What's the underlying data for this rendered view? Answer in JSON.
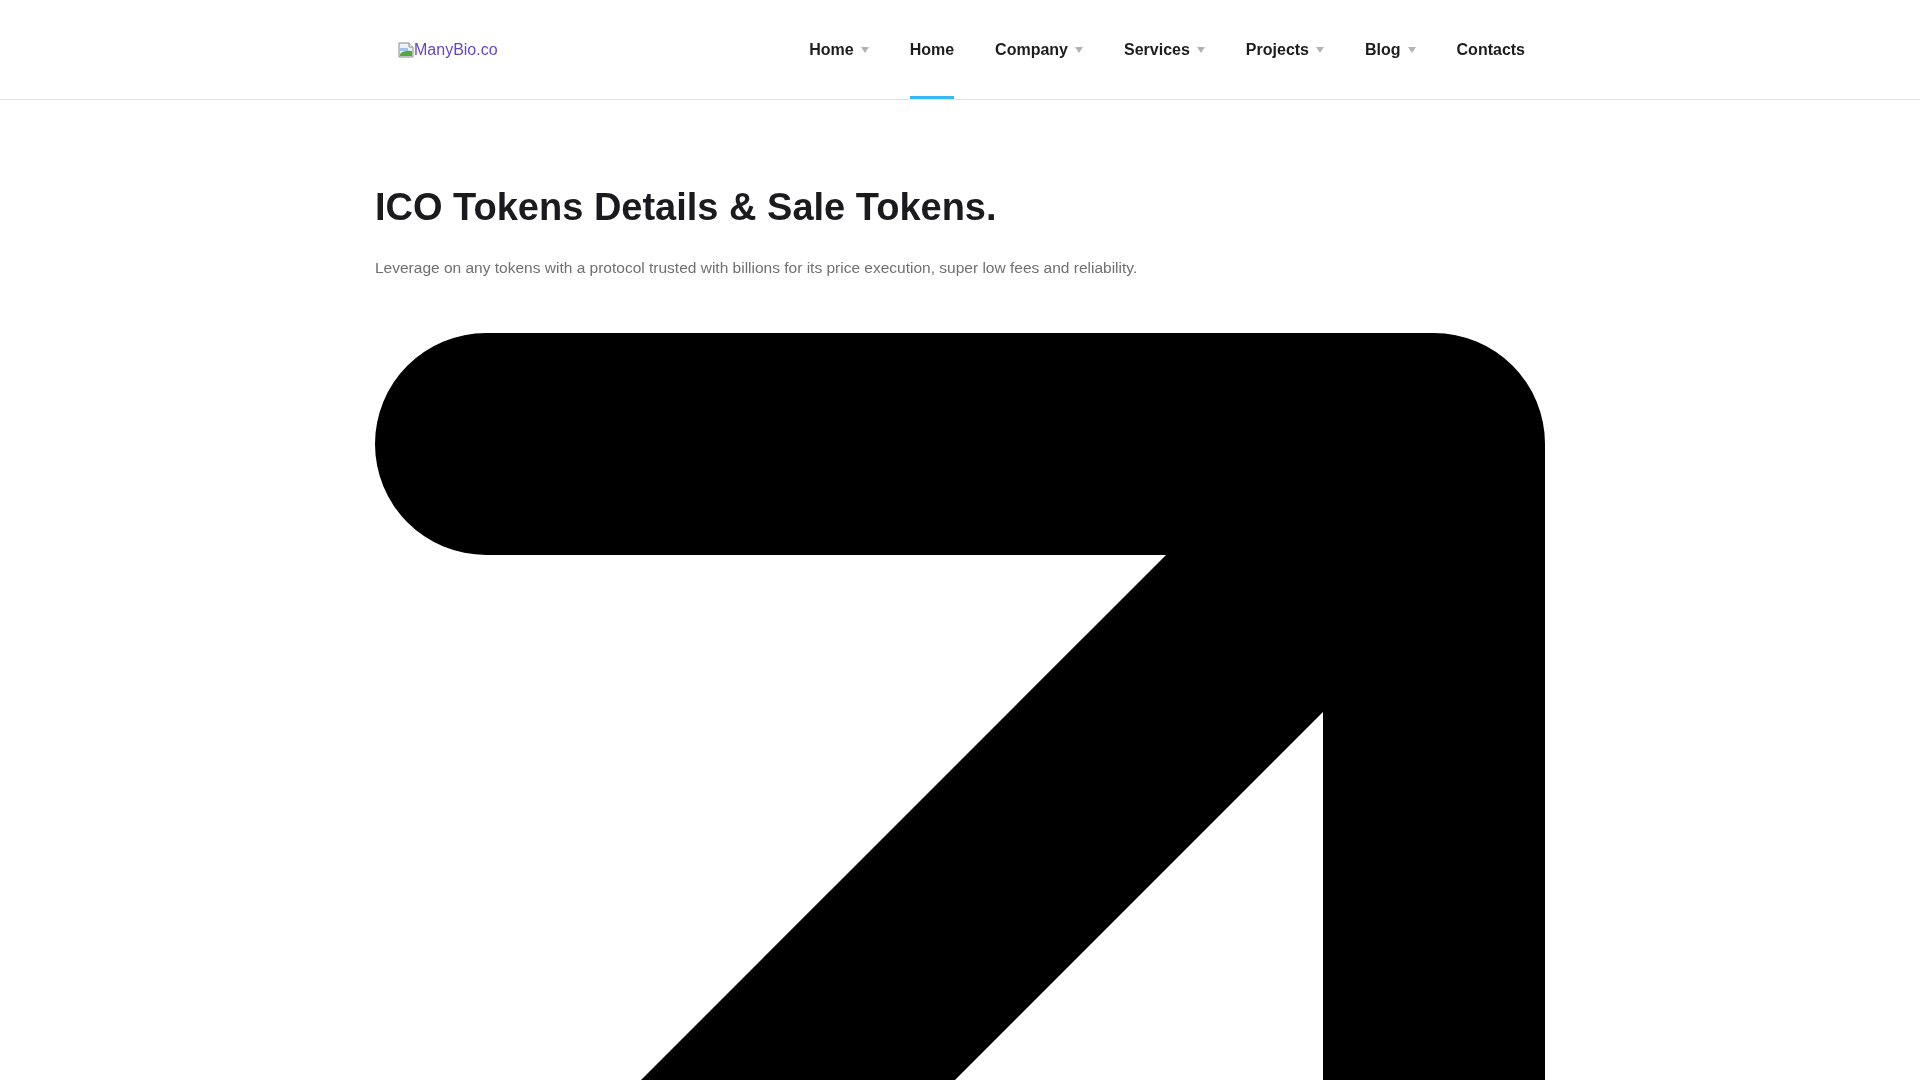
{
  "header": {
    "logo": {
      "text": "ManyBio.co"
    },
    "nav": [
      {
        "label": "Home",
        "has_dropdown": true,
        "selected": false
      },
      {
        "label": "Home",
        "has_dropdown": false,
        "selected": true
      },
      {
        "label": "Company",
        "has_dropdown": true,
        "selected": false
      },
      {
        "label": "Services",
        "has_dropdown": true,
        "selected": false
      },
      {
        "label": "Projects",
        "has_dropdown": true,
        "selected": false
      },
      {
        "label": "Blog",
        "has_dropdown": true,
        "selected": false
      },
      {
        "label": "Contacts",
        "has_dropdown": false,
        "selected": false
      }
    ]
  },
  "hero": {
    "title": "ICO Tokens Details & Sale Tokens.",
    "text": "Leverage on any tokens with a protocol trusted with billions for its price execution, super low fees and reliability."
  }
}
